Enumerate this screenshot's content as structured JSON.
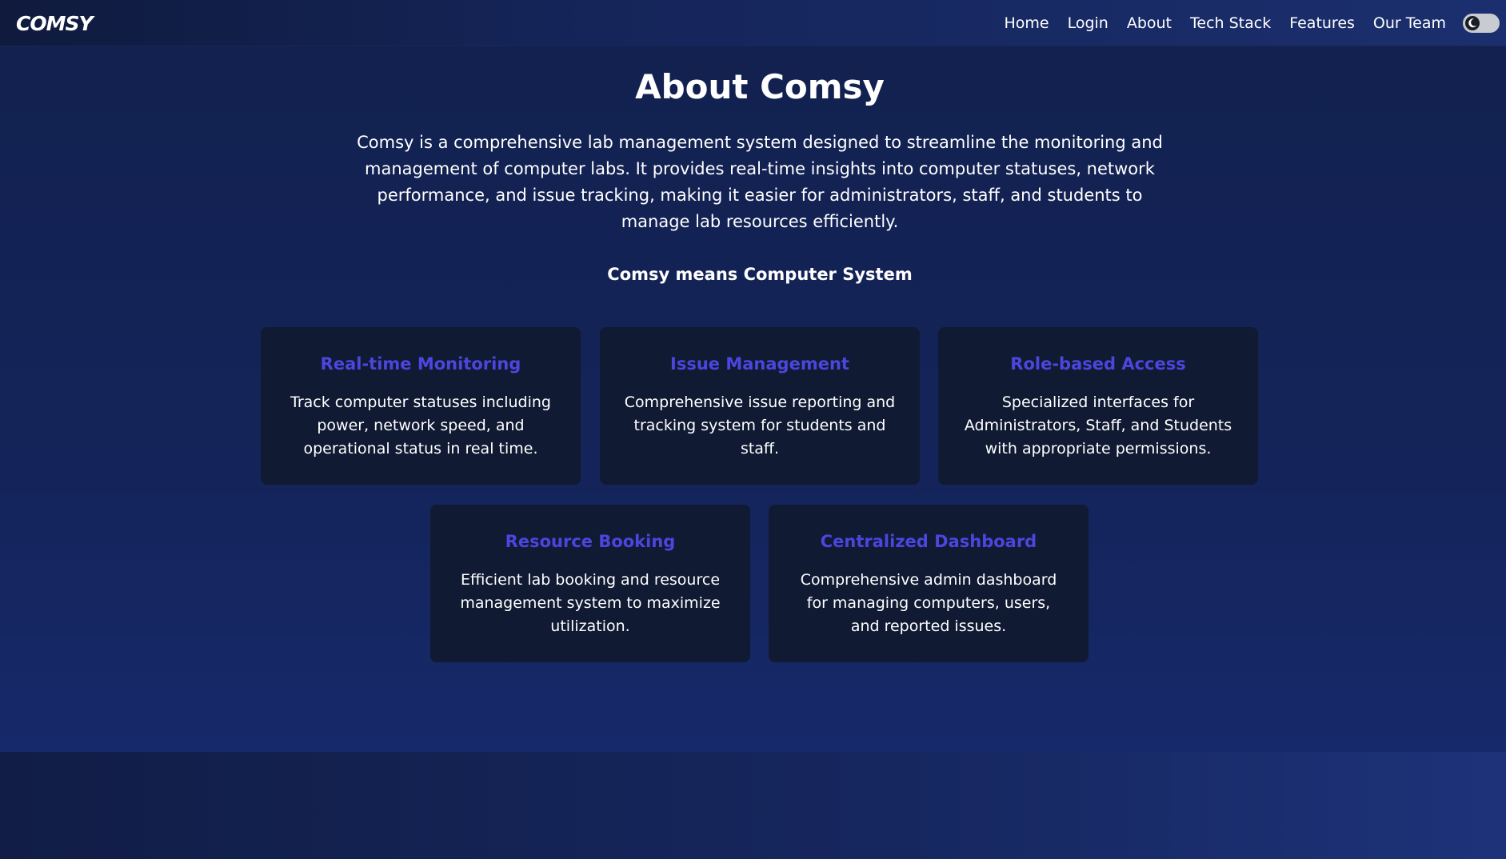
{
  "navbar": {
    "logo_text": "COMSY",
    "links": [
      "Home",
      "Login",
      "About",
      "Tech Stack",
      "Features",
      "Our Team"
    ],
    "theme_toggle_icon": "moon-icon"
  },
  "about": {
    "title": "About Comsy",
    "intro": "Comsy is a comprehensive lab management system designed to streamline the monitoring and management of computer labs. It provides real-time insights into computer statuses, network performance, and issue tracking, making it easier for administrators, staff, and students to manage lab resources efficiently.",
    "tagline": "Comsy means Computer System"
  },
  "features": [
    {
      "title": "Real-time Monitoring",
      "description": "Track computer statuses including power, network speed, and operational status in real time."
    },
    {
      "title": "Issue Management",
      "description": "Comprehensive issue reporting and tracking system for students and staff."
    },
    {
      "title": "Role-based Access",
      "description": "Specialized interfaces for Administrators, Staff, and Students with appropriate permissions."
    },
    {
      "title": "Resource Booking",
      "description": "Efficient lab booking and resource management system to maximize utilization."
    },
    {
      "title": "Centralized Dashboard",
      "description": "Comprehensive admin dashboard for managing computers, users, and reported issues."
    }
  ],
  "colors": {
    "accent": "#4c45de",
    "card_bg": "#101a33",
    "page_bg": "#12214f"
  }
}
